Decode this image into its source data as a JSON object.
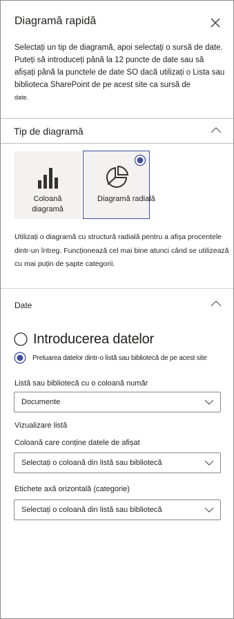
{
  "panel": {
    "title": "Diagramă rapidă",
    "intro_main": "Selectați un tip de diagramă, apoi selectați o sursă de date. Puteți să introduceți până la 12 puncte de date sau să afișați până la punctele de date SO dacă utilizați o Lista sau biblioteca SharePoint de pe acest site ca sursă de",
    "intro_small": "date."
  },
  "chart_type_section": {
    "header": "Tip de diagramă",
    "options": [
      {
        "label_line1": "Coloană",
        "label_line2": "diagramă",
        "icon": "bar-chart-icon",
        "selected": false
      },
      {
        "label": "Diagramă radială",
        "icon": "pie-chart-icon",
        "selected": true
      }
    ],
    "description": "Utilizați o diagramă cu structură radială pentru a afișa procentele dintr-un întreg. Funcționează cel mai bine atunci când se utilizează cu mai puțin de șapte categorii."
  },
  "data_section": {
    "header": "Date",
    "source_options": [
      {
        "label": "Introducerea datelor",
        "selected": false
      },
      {
        "label": "Preluarea datelor dintr-o listă sau bibliotecă de pe acest site",
        "selected": true
      }
    ],
    "list_label": "Listă sau bibliotecă cu o coloană număr",
    "list_value": "Documente",
    "view_label": "Vizualizare listă",
    "data_column_label": "Coloană care conține datele de afișat",
    "data_column_value": "Selectați o coloană din listă sau bibliotecă",
    "axis_label": "Etichete axă orizontală (categorie)",
    "axis_value": "Selectați o coloană din listă sau bibliotecă"
  },
  "colors": {
    "accent": "#3f4e9e",
    "tile_bg": "#f3f2f1",
    "border": "#8a8886",
    "text": "#201f1e"
  }
}
